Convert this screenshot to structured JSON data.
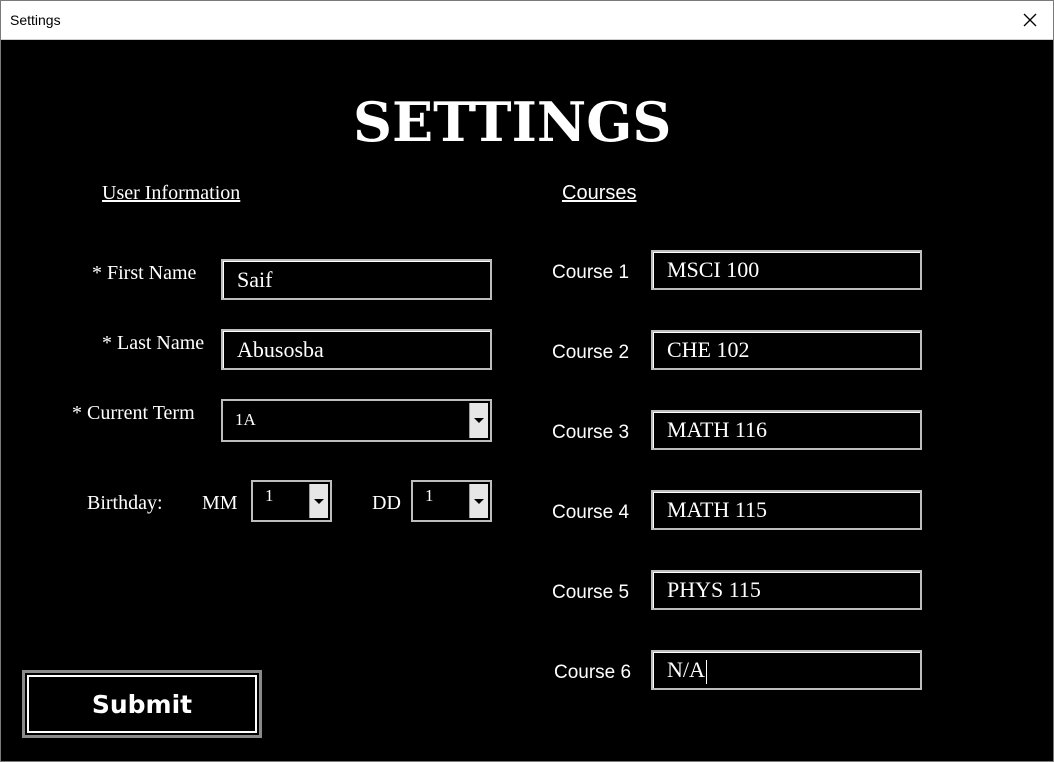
{
  "window": {
    "title": "Settings"
  },
  "heading": "SETTINGS",
  "user_info": {
    "section_title": "User Information",
    "first_name_label": "* First Name",
    "first_name_value": "Saif",
    "last_name_label": "* Last Name",
    "last_name_value": "Abusosba",
    "current_term_label": "* Current Term",
    "current_term_value": "1A",
    "birthday_label": "Birthday:",
    "mm_label": "MM",
    "mm_value": "1",
    "dd_label": "DD",
    "dd_value": "1"
  },
  "courses": {
    "section_title": "Courses",
    "items": [
      {
        "label": "Course 1",
        "value": "MSCI 100"
      },
      {
        "label": "Course 2",
        "value": "CHE 102"
      },
      {
        "label": "Course 3",
        "value": "MATH 116"
      },
      {
        "label": "Course 4",
        "value": "MATH 115"
      },
      {
        "label": "Course 5",
        "value": "PHYS 115"
      },
      {
        "label": "Course 6",
        "value": "N/A"
      }
    ]
  },
  "submit_label": "Submit",
  "icons": {
    "close": "close-icon",
    "dropdown": "chevron-down-icon"
  }
}
